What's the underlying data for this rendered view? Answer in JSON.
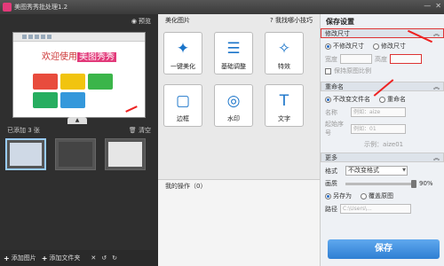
{
  "titlebar": {
    "title": "美图秀秀批处理1.2"
  },
  "left": {
    "preview_label": "预览",
    "preview_welcome": "欢迎使用",
    "preview_brand": "美图秀秀",
    "added_count": "已添加 3 张",
    "clear_label": "清空",
    "bottom": {
      "add_image": "添加图片",
      "add_folder": "添加文件夹"
    }
  },
  "middle": {
    "section_title": "美化图片",
    "tip_link": "我找哪小技巧",
    "tools": [
      {
        "icon": "magic-wand-icon",
        "label": "一键美化"
      },
      {
        "icon": "sliders-icon",
        "label": "基础调整"
      },
      {
        "icon": "sparkle-wand-icon",
        "label": "特效"
      },
      {
        "icon": "frame-icon",
        "label": "边框"
      },
      {
        "icon": "watermark-icon",
        "label": "水印"
      },
      {
        "icon": "text-icon",
        "label": "文字"
      }
    ],
    "history_label": "我的操作（0）"
  },
  "right": {
    "title": "保存设置",
    "resize": {
      "header": "修改尺寸",
      "option_keep": "不修改尺寸",
      "option_change": "修改尺寸",
      "width_label": "宽度",
      "height_label": "高度",
      "keep_ratio": "保持原图比例"
    },
    "rename": {
      "header": "重命名",
      "option_keep": "不改变文件名",
      "option_rename": "重命名",
      "name_label": "名称",
      "name_placeholder": "例如：aize",
      "start_label": "起始序号",
      "start_placeholder": "例如：01",
      "example": "示例：aize01"
    },
    "more": {
      "header": "更多",
      "format_label": "格式",
      "format_value": "不改变格式",
      "quality_label": "画质",
      "quality_value": "90%",
      "save_as": "另存为",
      "overwrite": "覆盖原图",
      "path_label": "路径",
      "path_value": "C:\\Users\\..."
    },
    "save_button": "保存"
  },
  "colors": {
    "accent": "#2f7fd3",
    "brand_pink": "#e23a7a",
    "highlight_red": "#dd3333"
  }
}
